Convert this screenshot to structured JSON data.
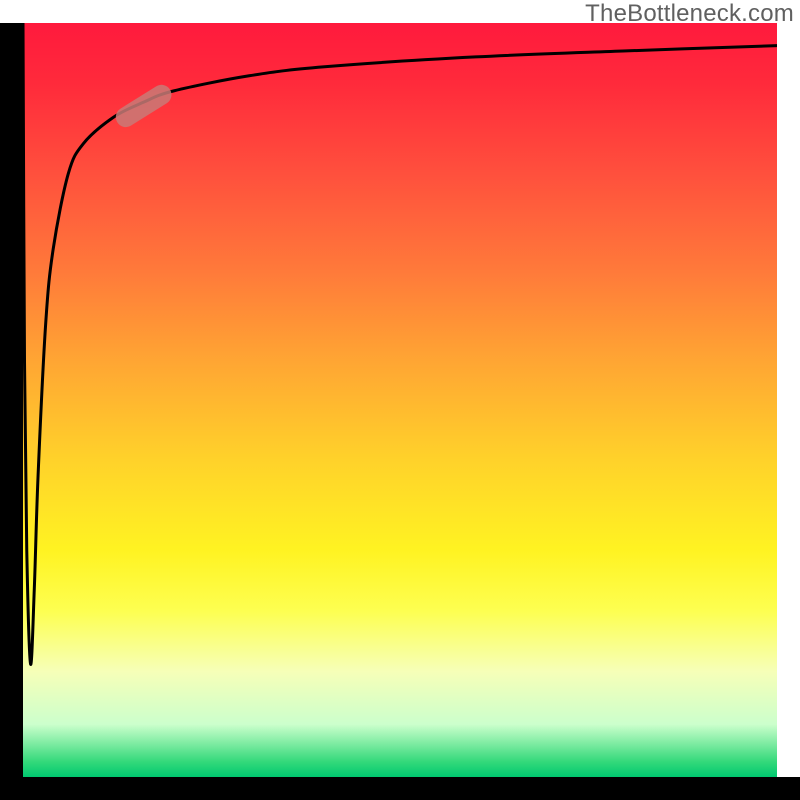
{
  "watermark": "TheBottleneck.com",
  "colors": {
    "axis": "#000000",
    "gradient_top": "#ff1a3d",
    "gradient_bottom": "#00c870",
    "curve": "#000000",
    "marker": "#c97a77"
  },
  "chart_data": {
    "type": "line",
    "title": "",
    "xlabel": "",
    "ylabel": "",
    "xlim": [
      0,
      100
    ],
    "ylim": [
      0,
      100
    ],
    "grid": false,
    "series": [
      {
        "name": "bottleneck-curve",
        "x": [
          0.0,
          0.2,
          0.5,
          1.0,
          1.5,
          2.0,
          3.0,
          4.0,
          6.0,
          8.0,
          12.0,
          16.0,
          20.0,
          30.0,
          40.0,
          60.0,
          80.0,
          100.0
        ],
        "values": [
          100,
          55,
          30,
          15,
          25,
          40,
          60,
          70,
          80,
          84,
          87.5,
          89.5,
          91,
          93,
          94.2,
          95.5,
          96.3,
          97.0
        ]
      }
    ],
    "annotations": [
      {
        "name": "highlighted-segment",
        "position_x": 16,
        "position_y": 89
      }
    ]
  }
}
